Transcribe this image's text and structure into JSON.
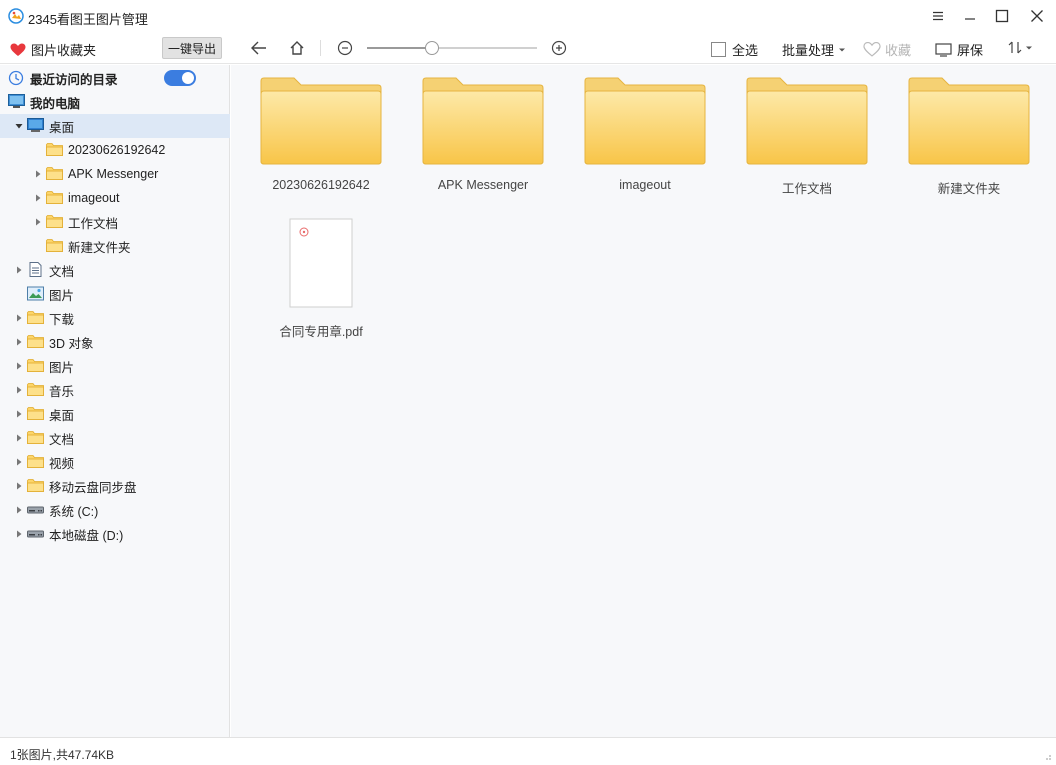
{
  "window": {
    "title": "2345看图王图片管理"
  },
  "toolbar": {
    "favorites_label": "图片收藏夹",
    "export_label": "一键导出",
    "select_all_label": "全选",
    "batch_label": "批量处理",
    "collect_label": "收藏",
    "screen_label": "屏保",
    "zoom_level": 0.38
  },
  "sidebar": {
    "recent_label": "最近访问的目录",
    "recent_enabled": true,
    "computer_label": "我的电脑",
    "items": [
      {
        "label": "桌面",
        "icon": "desktop-icon",
        "level": 1,
        "caret": "down",
        "selected": true
      },
      {
        "label": "20230626192642",
        "icon": "folder-icon",
        "level": 2,
        "caret": "none"
      },
      {
        "label": "APK Messenger",
        "icon": "folder-icon",
        "level": 2,
        "caret": "right"
      },
      {
        "label": "imageout",
        "icon": "folder-icon",
        "level": 2,
        "caret": "right"
      },
      {
        "label": "工作文档",
        "icon": "folder-icon",
        "level": 2,
        "caret": "right"
      },
      {
        "label": "新建文件夹",
        "icon": "folder-icon",
        "level": 2,
        "caret": "none"
      },
      {
        "label": "文档",
        "icon": "document-icon",
        "level": 1,
        "caret": "right"
      },
      {
        "label": "图片",
        "icon": "picture-icon",
        "level": 1,
        "caret": "none"
      },
      {
        "label": "下载",
        "icon": "folder-icon",
        "level": 1,
        "caret": "right"
      },
      {
        "label": "3D 对象",
        "icon": "folder-icon",
        "level": 1,
        "caret": "right"
      },
      {
        "label": "图片",
        "icon": "folder-icon",
        "level": 1,
        "caret": "right"
      },
      {
        "label": "音乐",
        "icon": "folder-icon",
        "level": 1,
        "caret": "right"
      },
      {
        "label": "桌面",
        "icon": "folder-icon",
        "level": 1,
        "caret": "right"
      },
      {
        "label": "文档",
        "icon": "folder-icon",
        "level": 1,
        "caret": "right"
      },
      {
        "label": "视频",
        "icon": "folder-icon",
        "level": 1,
        "caret": "right"
      },
      {
        "label": "移动云盘同步盘",
        "icon": "folder-icon",
        "level": 1,
        "caret": "right"
      },
      {
        "label": "系统 (C:)",
        "icon": "drive-icon",
        "level": 1,
        "caret": "right"
      },
      {
        "label": "本地磁盘 (D:)",
        "icon": "drive-icon",
        "level": 1,
        "caret": "right"
      }
    ]
  },
  "main": {
    "items": [
      {
        "name": "20230626192642",
        "type": "folder"
      },
      {
        "name": "APK Messenger",
        "type": "folder"
      },
      {
        "name": "imageout",
        "type": "folder"
      },
      {
        "name": "工作文档",
        "type": "folder"
      },
      {
        "name": "新建文件夹",
        "type": "folder"
      },
      {
        "name": "合同专用章.pdf",
        "type": "pdf"
      }
    ]
  },
  "status": {
    "text": "1张图片,共47.74KB"
  },
  "colors": {
    "accent": "#3b7de0",
    "folder_top": "#fbe29b",
    "folder_bottom": "#f7c64f",
    "heart": "#e8383d",
    "selected_row": "#dde8f6"
  }
}
